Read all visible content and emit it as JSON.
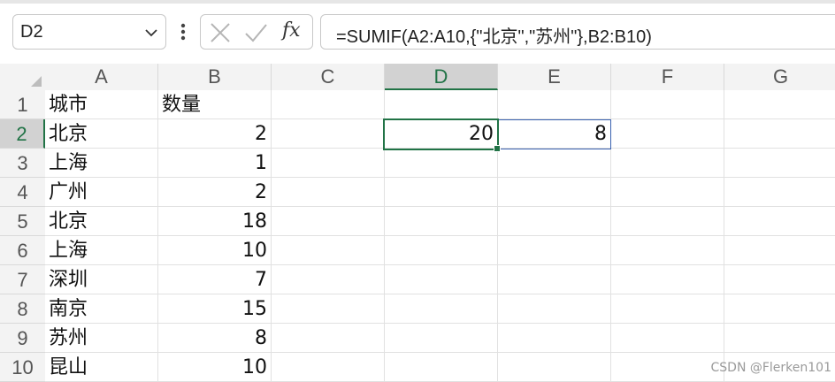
{
  "formula_bar": {
    "name_box": "D2",
    "formula": "=SUMIF(A2:A10,{\"北京\",\"苏州\"},B2:B10)",
    "cancel_icon": "close-icon",
    "enter_icon": "check-icon",
    "fx_label": "fx"
  },
  "columns": [
    "A",
    "B",
    "C",
    "D",
    "E",
    "F",
    "G"
  ],
  "rows": [
    "1",
    "2",
    "3",
    "4",
    "5",
    "6",
    "7",
    "8",
    "9",
    "10"
  ],
  "cells": {
    "A1": "城市",
    "B1": "数量",
    "A2": "北京",
    "B2": "2",
    "D2": "20",
    "E2": "8",
    "A3": "上海",
    "B3": "1",
    "A4": "广州",
    "B4": "2",
    "A5": "北京",
    "B5": "18",
    "A6": "上海",
    "B6": "10",
    "A7": "深圳",
    "B7": "7",
    "A8": "南京",
    "B8": "15",
    "A9": "苏州",
    "B9": "8",
    "A10": "昆山",
    "B10": "10"
  },
  "selection": {
    "active_cell": "D2",
    "selected_column": "D",
    "selected_row": "2"
  },
  "colors": {
    "accent": "#217346",
    "spill_border": "#3a62b0"
  },
  "watermark": "CSDN @Flerken101"
}
